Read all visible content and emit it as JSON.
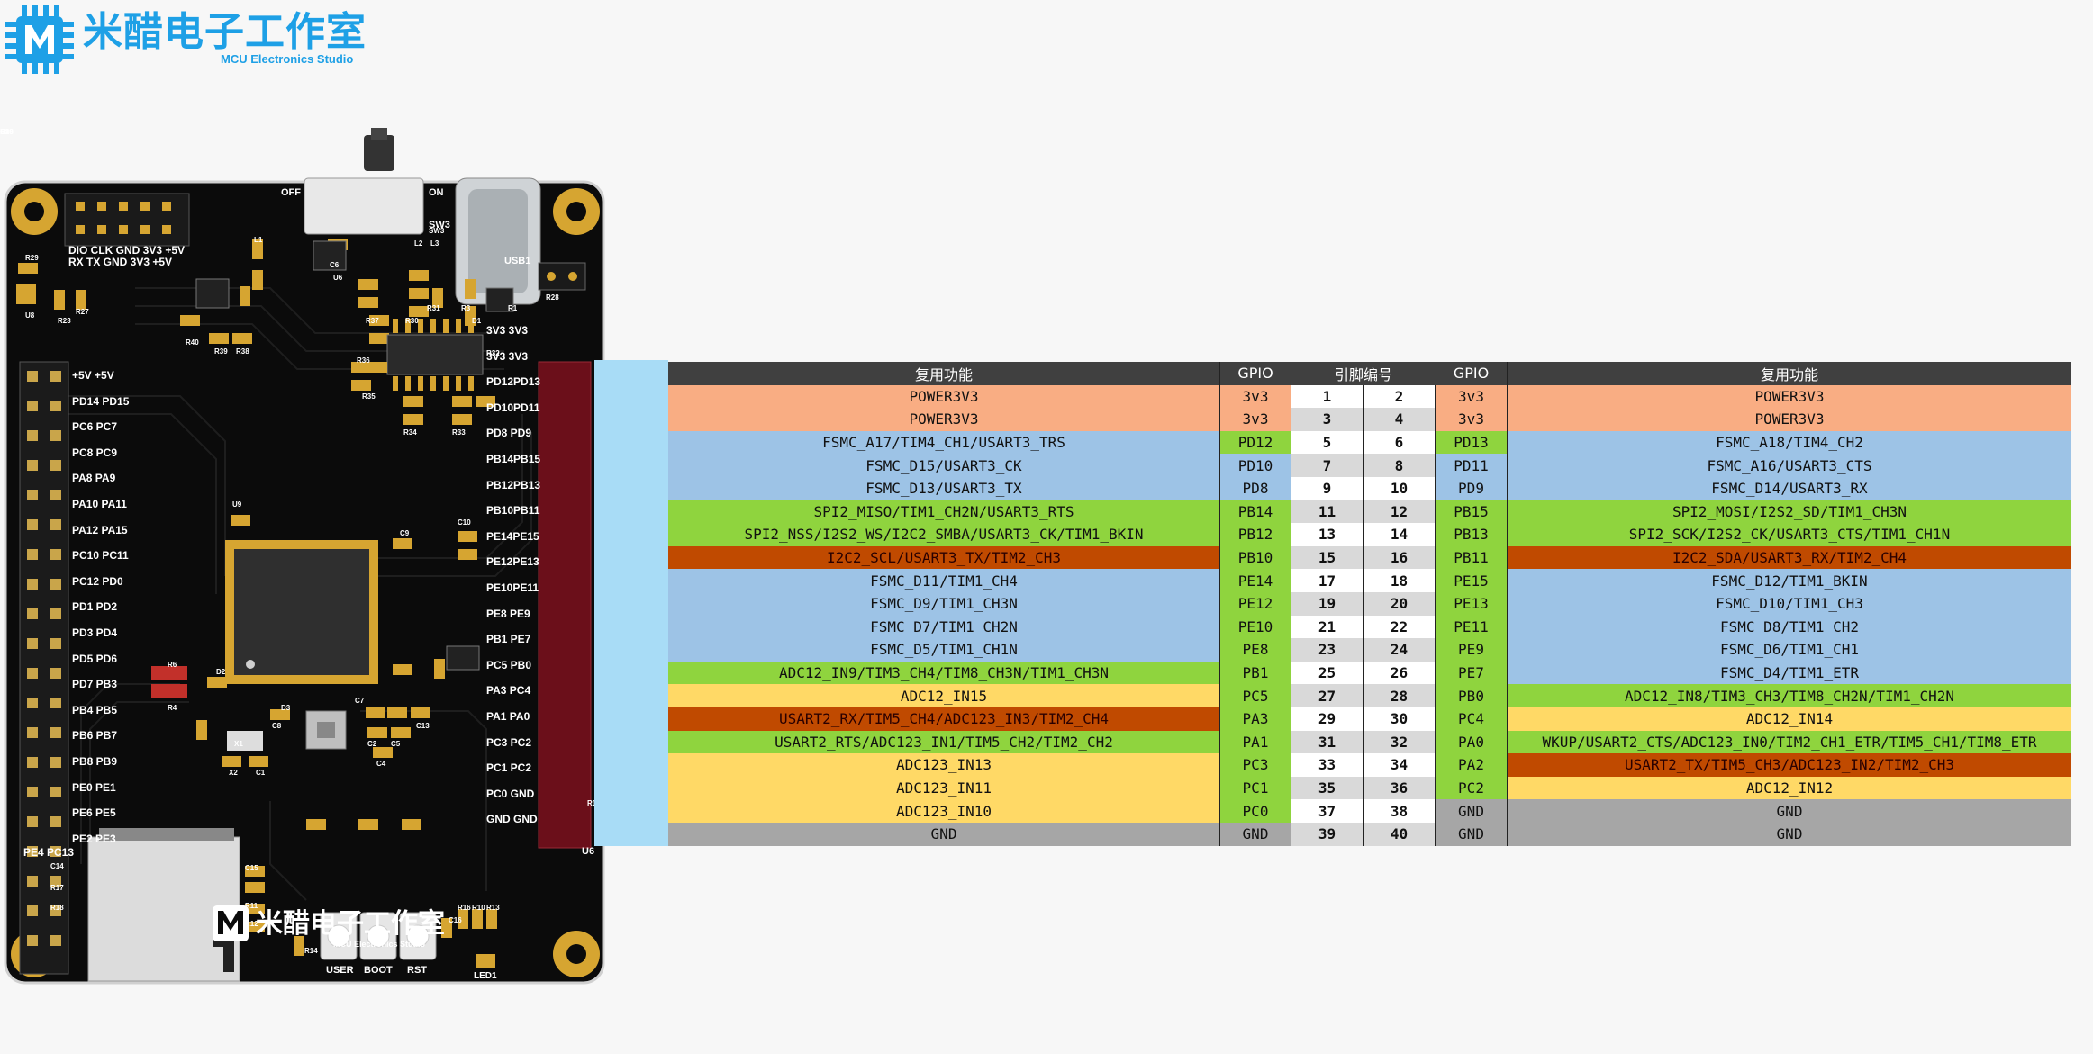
{
  "brand": {
    "name_cn": "米醋电子工作室",
    "name_en": "MCU Electronics Studio"
  },
  "board": {
    "power_switch": {
      "off": "OFF",
      "on": "ON",
      "ref": "SW3"
    },
    "debug_header": {
      "row1": "DIO CLK GND 3V3 +5V",
      "row2": "RX  TX  GND 3V3 +5V"
    },
    "left_header_labels": [
      "+5V +5V",
      "PD14 PD15",
      "PC6 PC7",
      "PC8 PC9",
      "PA8 PA9",
      "PA10 PA11",
      "PA12 PA15",
      "PC10 PC11",
      "PC12 PD0",
      "PD1 PD2",
      "PD3 PD4",
      "PD5 PD6",
      "PD7 PB3",
      "PB4 PB5",
      "PB6 PB7",
      "PB8 PB9",
      "PE0 PE1",
      "PE6 PE5",
      "PE2 PE3"
    ],
    "left_header_bottom": "PE4 PC13",
    "right_header_labels": [
      "3V3 3V3",
      "3V3 3V3",
      "PD12PD13",
      "PD10PD11",
      "PD8 PD9",
      "PB14PB15",
      "PB12PB13",
      "PB10PB11",
      "PE14PE15",
      "PE12PE13",
      "PE10PE11",
      "PE8 PE9",
      "PB1 PE7",
      "PC5 PB0",
      "PA3 PC4",
      "PA1 PA0",
      "PC3 PC2",
      "PC1 PC2",
      "PC0 GND",
      "GND GND"
    ],
    "right_header_ref": "U6",
    "buttons": [
      "USER",
      "BOOT",
      "RST"
    ],
    "led": "LED1",
    "usb_ref": "USB1",
    "refs": [
      "R29",
      "R28",
      "R27",
      "R23",
      "U8",
      "L1",
      "C6",
      "U6",
      "R37",
      "R30",
      "R31",
      "R3",
      "D1",
      "R1",
      "L2",
      "L3",
      "SW3",
      "R36",
      "R35",
      "R34",
      "R33",
      "R32",
      "U9",
      "C9",
      "C10",
      "R6",
      "R4",
      "D2",
      "D3",
      "C8",
      "C7",
      "X1",
      "X2",
      "C1",
      "C2",
      "C5",
      "C4",
      "C13",
      "C14",
      "R17",
      "R18",
      "C16",
      "C15",
      "R11",
      "R12",
      "R16",
      "R10",
      "R13",
      "R14",
      "R15",
      "R40",
      "R39",
      "R38",
      "R2",
      "U5",
      "C20",
      "C19",
      "C18"
    ]
  },
  "table": {
    "headers": {
      "func_left": "复用功能",
      "gpio_left": "GPIO",
      "pin": "引脚编号",
      "gpio_right": "GPIO",
      "func_right": "复用功能"
    },
    "colors": {
      "power": "#f9ad83",
      "blue": "#9dc3e6",
      "green": "#8fd43e",
      "red": "#c04a00",
      "yellow": "#ffd966",
      "gray": "#a6a6a6",
      "header": "#404040"
    },
    "rows": [
      {
        "lf": "POWER3V3",
        "lg": "3v3",
        "lp": "1",
        "rp": "2",
        "rg": "3v3",
        "rf": "POWER3V3",
        "lc": "power",
        "rc": "power"
      },
      {
        "lf": "POWER3V3",
        "lg": "3v3",
        "lp": "3",
        "rp": "4",
        "rg": "3v3",
        "rf": "POWER3V3",
        "lc": "power",
        "rc": "power"
      },
      {
        "lf": "FSMC_A17/TIM4_CH1/USART3_TRS",
        "lg": "PD12",
        "lp": "5",
        "rp": "6",
        "rg": "PD13",
        "rf": "FSMC_A18/TIM4_CH2",
        "lc": "blue",
        "rc": "blue",
        "lgc": "green",
        "rgc": "green"
      },
      {
        "lf": "FSMC_D15/USART3_CK",
        "lg": "PD10",
        "lp": "7",
        "rp": "8",
        "rg": "PD11",
        "rf": "FSMC_A16/USART3_CTS",
        "lc": "blue",
        "rc": "blue"
      },
      {
        "lf": "FSMC_D13/USART3_TX",
        "lg": "PD8",
        "lp": "9",
        "rp": "10",
        "rg": "PD9",
        "rf": "FSMC_D14/USART3_RX",
        "lc": "blue",
        "rc": "blue"
      },
      {
        "lf": "SPI2_MISO/TIM1_CH2N/USART3_RTS",
        "lg": "PB14",
        "lp": "11",
        "rp": "12",
        "rg": "PB15",
        "rf": "SPI2_MOSI/I2S2_SD/TIM1_CH3N",
        "lc": "green",
        "rc": "green"
      },
      {
        "lf": "SPI2_NSS/I2S2_WS/I2C2_SMBA/USART3_CK/TIM1_BKIN",
        "lg": "PB12",
        "lp": "13",
        "rp": "14",
        "rg": "PB13",
        "rf": "SPI2_SCK/I2S2_CK/USART3_CTS/TIM1_CH1N",
        "lc": "green",
        "rc": "green"
      },
      {
        "lf": "I2C2_SCL/USART3_TX/TIM2_CH3",
        "lg": "PB10",
        "lp": "15",
        "rp": "16",
        "rg": "PB11",
        "rf": "I2C2_SDA/USART3_RX/TIM2_CH4",
        "lc": "red",
        "rc": "red",
        "lgc": "green",
        "rgc": "green"
      },
      {
        "lf": "FSMC_D11/TIM1_CH4",
        "lg": "PE14",
        "lp": "17",
        "rp": "18",
        "rg": "PE15",
        "rf": "FSMC_D12/TIM1_BKIN",
        "lc": "blue",
        "rc": "blue",
        "lgc": "green",
        "rgc": "green"
      },
      {
        "lf": "FSMC_D9/TIM1_CH3N",
        "lg": "PE12",
        "lp": "19",
        "rp": "20",
        "rg": "PE13",
        "rf": "FSMC_D10/TIM1_CH3",
        "lc": "blue",
        "rc": "blue",
        "lgc": "green",
        "rgc": "green"
      },
      {
        "lf": "FSMC_D7/TIM1_CH2N",
        "lg": "PE10",
        "lp": "21",
        "rp": "22",
        "rg": "PE11",
        "rf": "FSMC_D8/TIM1_CH2",
        "lc": "blue",
        "rc": "blue",
        "lgc": "green",
        "rgc": "green"
      },
      {
        "lf": "FSMC_D5/TIM1_CH1N",
        "lg": "PE8",
        "lp": "23",
        "rp": "24",
        "rg": "PE9",
        "rf": "FSMC_D6/TIM1_CH1",
        "lc": "blue",
        "rc": "blue",
        "lgc": "green",
        "rgc": "green"
      },
      {
        "lf": "ADC12_IN9/TIM3_CH4/TIM8_CH3N/TIM1_CH3N",
        "lg": "PB1",
        "lp": "25",
        "rp": "26",
        "rg": "PE7",
        "rf": "FSMC_D4/TIM1_ETR",
        "lc": "green",
        "rc": "blue",
        "lgc": "green",
        "rgc": "green"
      },
      {
        "lf": "ADC12_IN15",
        "lg": "PC5",
        "lp": "27",
        "rp": "28",
        "rg": "PB0",
        "rf": "ADC12_IN8/TIM3_CH3/TIM8_CH2N/TIM1_CH2N",
        "lc": "yellow",
        "rc": "green",
        "lgc": "green",
        "rgc": "green"
      },
      {
        "lf": "USART2_RX/TIM5_CH4/ADC123_IN3/TIM2_CH4",
        "lg": "PA3",
        "lp": "29",
        "rp": "30",
        "rg": "PC4",
        "rf": "ADC12_IN14",
        "lc": "red",
        "rc": "yellow",
        "lgc": "green",
        "rgc": "green"
      },
      {
        "lf": "USART2_RTS/ADC123_IN1/TIM5_CH2/TIM2_CH2",
        "lg": "PA1",
        "lp": "31",
        "rp": "32",
        "rg": "PA0",
        "rf": "WKUP/USART2_CTS/ADC123_IN0/TIM2_CH1_ETR/TIM5_CH1/TIM8_ETR",
        "lc": "green",
        "rc": "green",
        "lgc": "green",
        "rgc": "green"
      },
      {
        "lf": "ADC123_IN13",
        "lg": "PC3",
        "lp": "33",
        "rp": "34",
        "rg": "PA2",
        "rf": "USART2_TX/TIM5_CH3/ADC123_IN2/TIM2_CH3",
        "lc": "yellow",
        "rc": "red",
        "lgc": "green",
        "rgc": "green"
      },
      {
        "lf": "ADC123_IN11",
        "lg": "PC1",
        "lp": "35",
        "rp": "36",
        "rg": "PC2",
        "rf": "ADC12_IN12",
        "lc": "yellow",
        "rc": "yellow",
        "lgc": "green",
        "rgc": "green"
      },
      {
        "lf": "ADC123_IN10",
        "lg": "PC0",
        "lp": "37",
        "rp": "38",
        "rg": "GND",
        "rf": "GND",
        "lc": "yellow",
        "rc": "gray",
        "lgc": "green",
        "rgc": "gray"
      },
      {
        "lf": "GND",
        "lg": "GND",
        "lp": "39",
        "rp": "40",
        "rg": "GND",
        "rf": "GND",
        "lc": "gray",
        "rc": "gray",
        "lgc": "gray",
        "rgc": "gray"
      }
    ]
  }
}
